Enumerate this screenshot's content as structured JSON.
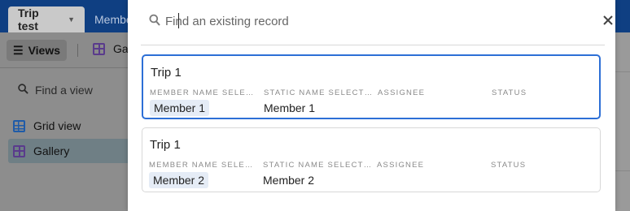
{
  "background": {
    "tabs": [
      {
        "label": "Trip test",
        "active": true
      },
      {
        "label": "Member",
        "active": false
      }
    ],
    "toolbar": {
      "views_label": "Views",
      "gallery_label": "Ga"
    },
    "sidebar": {
      "search_placeholder": "Find a view",
      "items": [
        {
          "label": "Grid view",
          "icon": "grid-view-icon"
        },
        {
          "label": "Gallery",
          "icon": "gallery-view-icon",
          "selected": true
        }
      ]
    }
  },
  "modal": {
    "search": {
      "placeholder": "Find an existing record",
      "value": ""
    },
    "records": [
      {
        "title": "Trip 1",
        "selected": true,
        "fields": [
          {
            "label": "MEMBER NAME SELECTED",
            "value": "Member 1",
            "style": "chip"
          },
          {
            "label": "STATIC NAME SELECTED",
            "value": "Member 1",
            "style": "plain"
          },
          {
            "label": "ASSIGNEE",
            "value": "",
            "style": "plain"
          },
          {
            "label": "STATUS",
            "value": "",
            "style": "plain"
          }
        ]
      },
      {
        "title": "Trip 1",
        "selected": false,
        "fields": [
          {
            "label": "MEMBER NAME SELECTED",
            "value": "Member 2",
            "style": "chip"
          },
          {
            "label": "STATIC NAME SELECTED",
            "value": "Member 2",
            "style": "plain"
          },
          {
            "label": "ASSIGNEE",
            "value": "",
            "style": "plain"
          },
          {
            "label": "STATUS",
            "value": "",
            "style": "plain"
          }
        ]
      }
    ]
  },
  "colors": {
    "accent": "#2d6fd6",
    "tabbar": "#0f3f82",
    "chip_bg": "#e5ecf6"
  }
}
